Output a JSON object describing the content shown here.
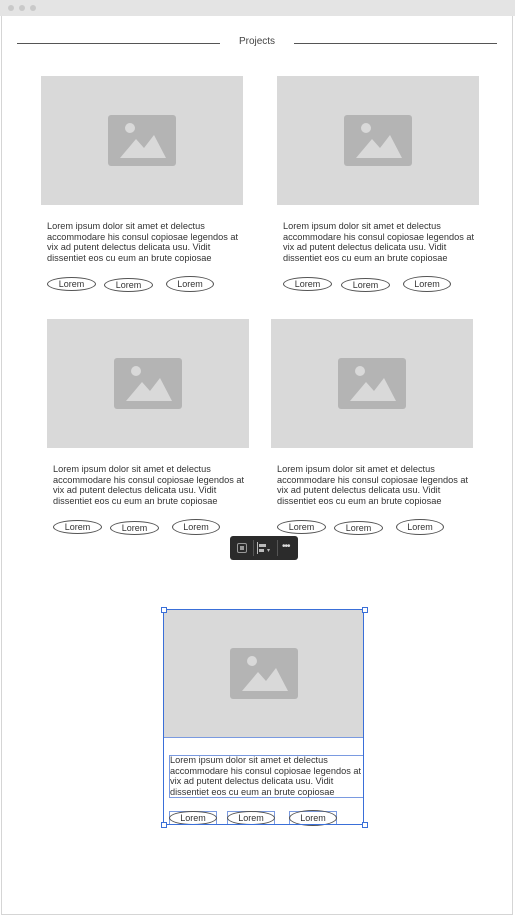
{
  "heading": "Projects",
  "cards": [
    {
      "text": "Lorem ipsum dolor sit amet et delectus\naccommodare his consul copiosae legendos at\nvix ad putent delectus delicata usu. Vidit\ndissentiet eos cu eum an brute copiosae",
      "tags": [
        "Lorem",
        "Lorem",
        "Lorem"
      ]
    },
    {
      "text": "Lorem ipsum dolor sit amet et delectus\naccommodare his consul copiosae legendos at\nvix ad putent delectus delicata usu. Vidit\ndissentiet eos cu eum an brute copiosae",
      "tags": [
        "Lorem",
        "Lorem",
        "Lorem"
      ]
    },
    {
      "text": "Lorem ipsum dolor sit amet et delectus\naccommodare his consul copiosae legendos at\nvix ad putent delectus delicata usu. Vidit\ndissentiet eos cu eum an brute copiosae",
      "tags": [
        "Lorem",
        "Lorem",
        "Lorem"
      ]
    },
    {
      "text": "Lorem ipsum dolor sit amet et delectus\naccommodare his consul copiosae legendos at\nvix ad putent delectus delicata usu. Vidit\ndissentiet eos cu eum an brute copiosae",
      "tags": [
        "Lorem",
        "Lorem",
        "Lorem"
      ]
    },
    {
      "text": "Lorem ipsum dolor sit amet et delectus\naccommodare his consul copiosae legendos at\nvix ad putent delectus delicata usu. Vidit\ndissentiet eos cu eum an brute copiosae",
      "tags": [
        "Lorem",
        "Lorem",
        "Lorem"
      ]
    }
  ],
  "toolbar": {
    "icons": [
      "group-icon",
      "align-icon",
      "more-icon"
    ]
  },
  "colors": {
    "placeholder": "#d9d9d9",
    "placeholder_icon": "#b4b4b4",
    "selection": "#3a6fd8",
    "toolbar": "#2b2b2b"
  }
}
